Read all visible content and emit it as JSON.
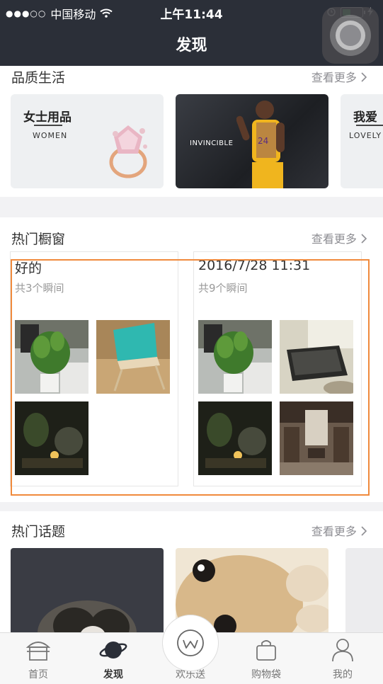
{
  "status_bar": {
    "signal": "●●●○○",
    "carrier": "中国移动",
    "time": "上午11:44"
  },
  "nav": {
    "title": "发现"
  },
  "quality_life": {
    "title": "品质生活",
    "more": "查看更多",
    "cards": [
      {
        "title": "女士用品",
        "subtitle": "WOMEN"
      },
      {
        "title": "",
        "subtitle": "INVINCIBLE"
      },
      {
        "title": "我爱",
        "subtitle": "LOVELY"
      }
    ]
  },
  "hot_windows": {
    "title": "热门橱窗",
    "more": "查看更多",
    "items": [
      {
        "title": "好的",
        "subtitle": "共3个瞬间",
        "photos": [
          "plant-office-photo",
          "teal-chair-photo",
          "dim-room-photo"
        ]
      },
      {
        "title": "2016/7/28 11:31",
        "subtitle": "共9个瞬间",
        "photos": [
          "plant-office-photo",
          "keyboard-desk-photo",
          "dim-room-photo",
          "chinese-interior-photo"
        ]
      }
    ]
  },
  "hot_topics": {
    "title": "热门话题",
    "more": "查看更多"
  },
  "tabbar": {
    "tabs": [
      {
        "label": "首页"
      },
      {
        "label": "发现"
      },
      {
        "label": "欢乐送"
      },
      {
        "label": "购物袋"
      },
      {
        "label": "我的"
      }
    ]
  },
  "colors": {
    "nav_bg": "#2b2f38",
    "highlight": "#f08a3c",
    "battery": "#4cd964"
  }
}
